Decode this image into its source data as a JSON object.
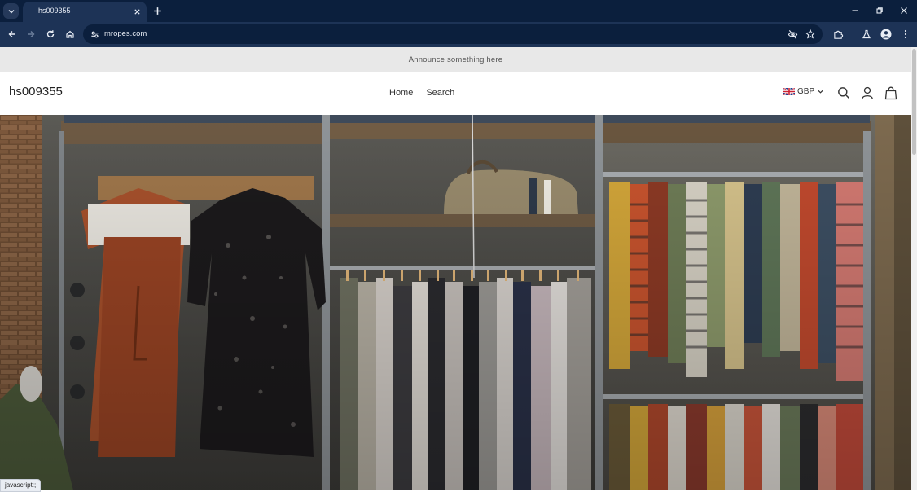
{
  "browser": {
    "tab_title": "hs009355",
    "url": "mropes.com",
    "status_text": "javascript:;",
    "colors": {
      "frame": "#0b1f3d",
      "toolbar": "#1d3356"
    }
  },
  "page": {
    "announcement": "Announce something here",
    "logo_text": "hs009355",
    "nav": [
      {
        "label": "Home"
      },
      {
        "label": "Search"
      }
    ],
    "currency": {
      "code": "GBP",
      "flag": "uk-flag-icon"
    },
    "header_icons": [
      "search-icon",
      "account-icon",
      "cart-icon"
    ],
    "hero": {
      "description_icon": "clothing-store-photo"
    }
  }
}
